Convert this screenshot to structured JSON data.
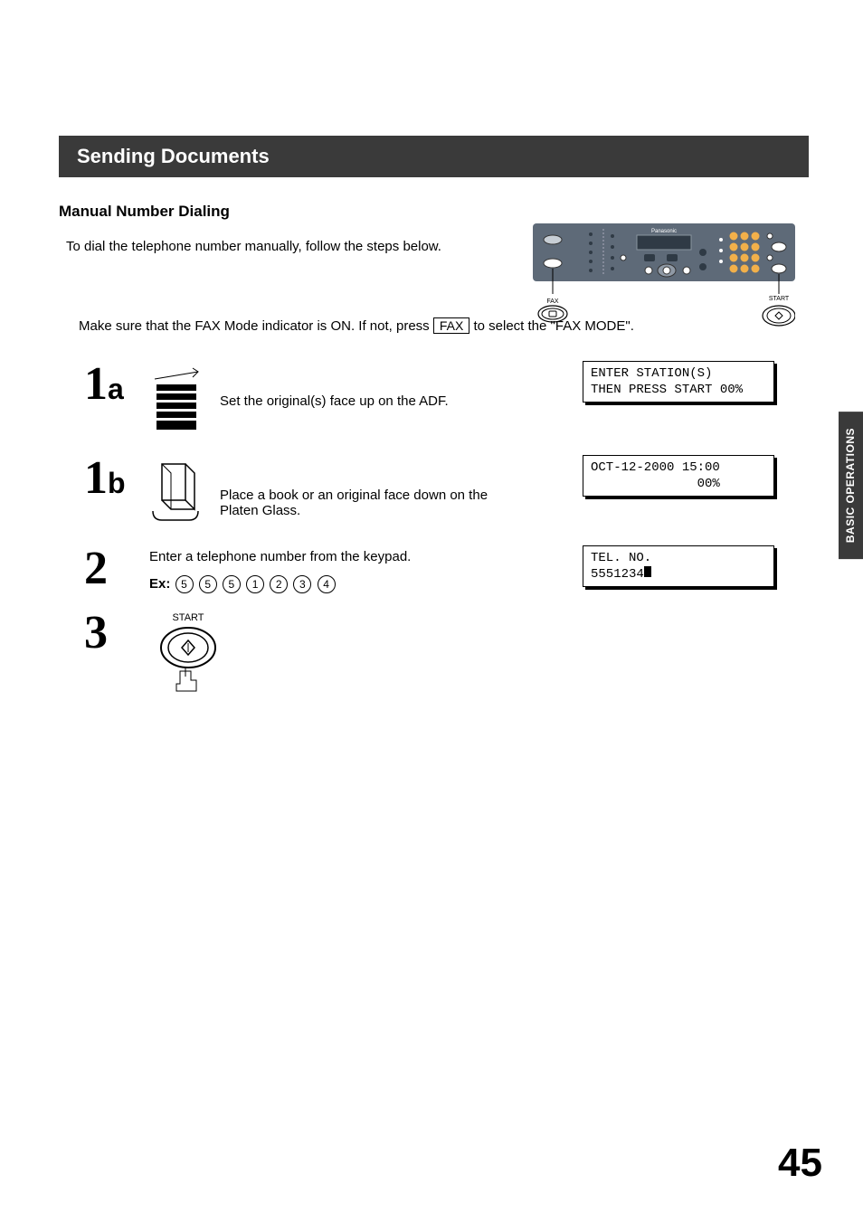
{
  "section_header": "Sending Documents",
  "subhead": "Manual Number Dialing",
  "intro": "To dial the telephone number manually, follow the steps below.",
  "panel_labels": {
    "brand": "Panasonic",
    "fax": "FAX",
    "start": "START"
  },
  "modeline": {
    "prefix": "Make sure that the FAX Mode indicator is ON.  If not, press ",
    "key": "FAX",
    "suffix": " to select the \"FAX MODE\"."
  },
  "steps": {
    "s1a": {
      "num": "1",
      "sub": "a",
      "text": "Set the original(s) face up on the ADF.",
      "lcd": "ENTER STATION(S)\nTHEN PRESS START 00%"
    },
    "s1b": {
      "num": "1",
      "sub": "b",
      "text": "Place a book or an original face down on the Platen Glass.",
      "lcd": "OCT-12-2000 15:00\n              00%"
    },
    "s2": {
      "num": "2",
      "text": "Enter a telephone number from the keypad.",
      "ex_label": "Ex:",
      "digits": [
        "5",
        "5",
        "5",
        "1",
        "2",
        "3",
        "4"
      ],
      "lcd": "TEL. NO.\n5551234"
    },
    "s3": {
      "num": "3",
      "start_label": "START"
    }
  },
  "side_tab": "BASIC\nOPERATIONS",
  "page_number": "45"
}
